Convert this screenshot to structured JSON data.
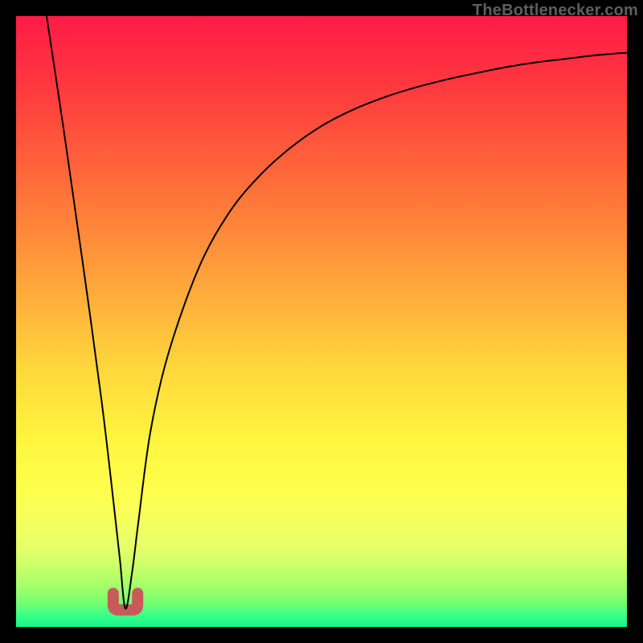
{
  "watermark": {
    "text": "TheBottlenecker.com"
  },
  "frame": {
    "outer_size_px": 800,
    "border_px": 20,
    "border_color": "#000000"
  },
  "gradient": {
    "direction": "top-to-bottom",
    "stops": [
      {
        "pos": 0.0,
        "color": "#ff1b47"
      },
      {
        "pos": 0.12,
        "color": "#ff3a3e"
      },
      {
        "pos": 0.28,
        "color": "#ff6f3a"
      },
      {
        "pos": 0.44,
        "color": "#ffa63b"
      },
      {
        "pos": 0.58,
        "color": "#ffd83c"
      },
      {
        "pos": 0.7,
        "color": "#fff63f"
      },
      {
        "pos": 0.78,
        "color": "#fdff4e"
      },
      {
        "pos": 0.83,
        "color": "#f4ff5e"
      },
      {
        "pos": 0.87,
        "color": "#e6ff6a"
      },
      {
        "pos": 0.9,
        "color": "#caff69"
      },
      {
        "pos": 0.93,
        "color": "#a9ff69"
      },
      {
        "pos": 0.96,
        "color": "#77ff72"
      },
      {
        "pos": 0.985,
        "color": "#2fff8a"
      },
      {
        "pos": 1.0,
        "color": "#16f58b"
      }
    ]
  },
  "curve": {
    "stroke": "#000000",
    "stroke_width": 2.0,
    "notch": {
      "color": "#c85a5a",
      "stroke_width": 14,
      "x_center_frac": 0.179,
      "half_width_frac": 0.02,
      "top_frac": 0.945,
      "bottom_frac": 0.972
    }
  },
  "chart_data": {
    "type": "line",
    "title": "",
    "xlabel": "",
    "ylabel": "",
    "xlim": [
      0,
      1
    ],
    "ylim": [
      0,
      1
    ],
    "note": "Axes are unlabeled. x and y are normalized fractions of the inner plot area (0 = left/bottom, 1 = right/top). The curve is a V/funnel shape: near-vertical descent from top-left to a floor minimum near x≈0.18, then a concave-up rise toward top-right.",
    "x": [
      0.05,
      0.08,
      0.11,
      0.14,
      0.16,
      0.17,
      0.179,
      0.19,
      0.2,
      0.22,
      0.25,
      0.3,
      0.35,
      0.4,
      0.45,
      0.5,
      0.55,
      0.6,
      0.65,
      0.7,
      0.75,
      0.8,
      0.85,
      0.9,
      0.95,
      1.0
    ],
    "y": [
      1.0,
      0.8,
      0.59,
      0.37,
      0.2,
      0.11,
      0.03,
      0.09,
      0.17,
      0.32,
      0.45,
      0.59,
      0.68,
      0.74,
      0.785,
      0.82,
      0.846,
      0.866,
      0.882,
      0.895,
      0.906,
      0.916,
      0.924,
      0.93,
      0.936,
      0.94
    ],
    "minimum": {
      "x": 0.179,
      "y": 0.03
    },
    "notch_marker": {
      "description": "Thick desaturated-red U at the curve minimum",
      "color": "#c85a5a",
      "x_center": 0.179,
      "half_width": 0.02,
      "y_top": 0.055,
      "y_bottom": 0.028
    }
  }
}
